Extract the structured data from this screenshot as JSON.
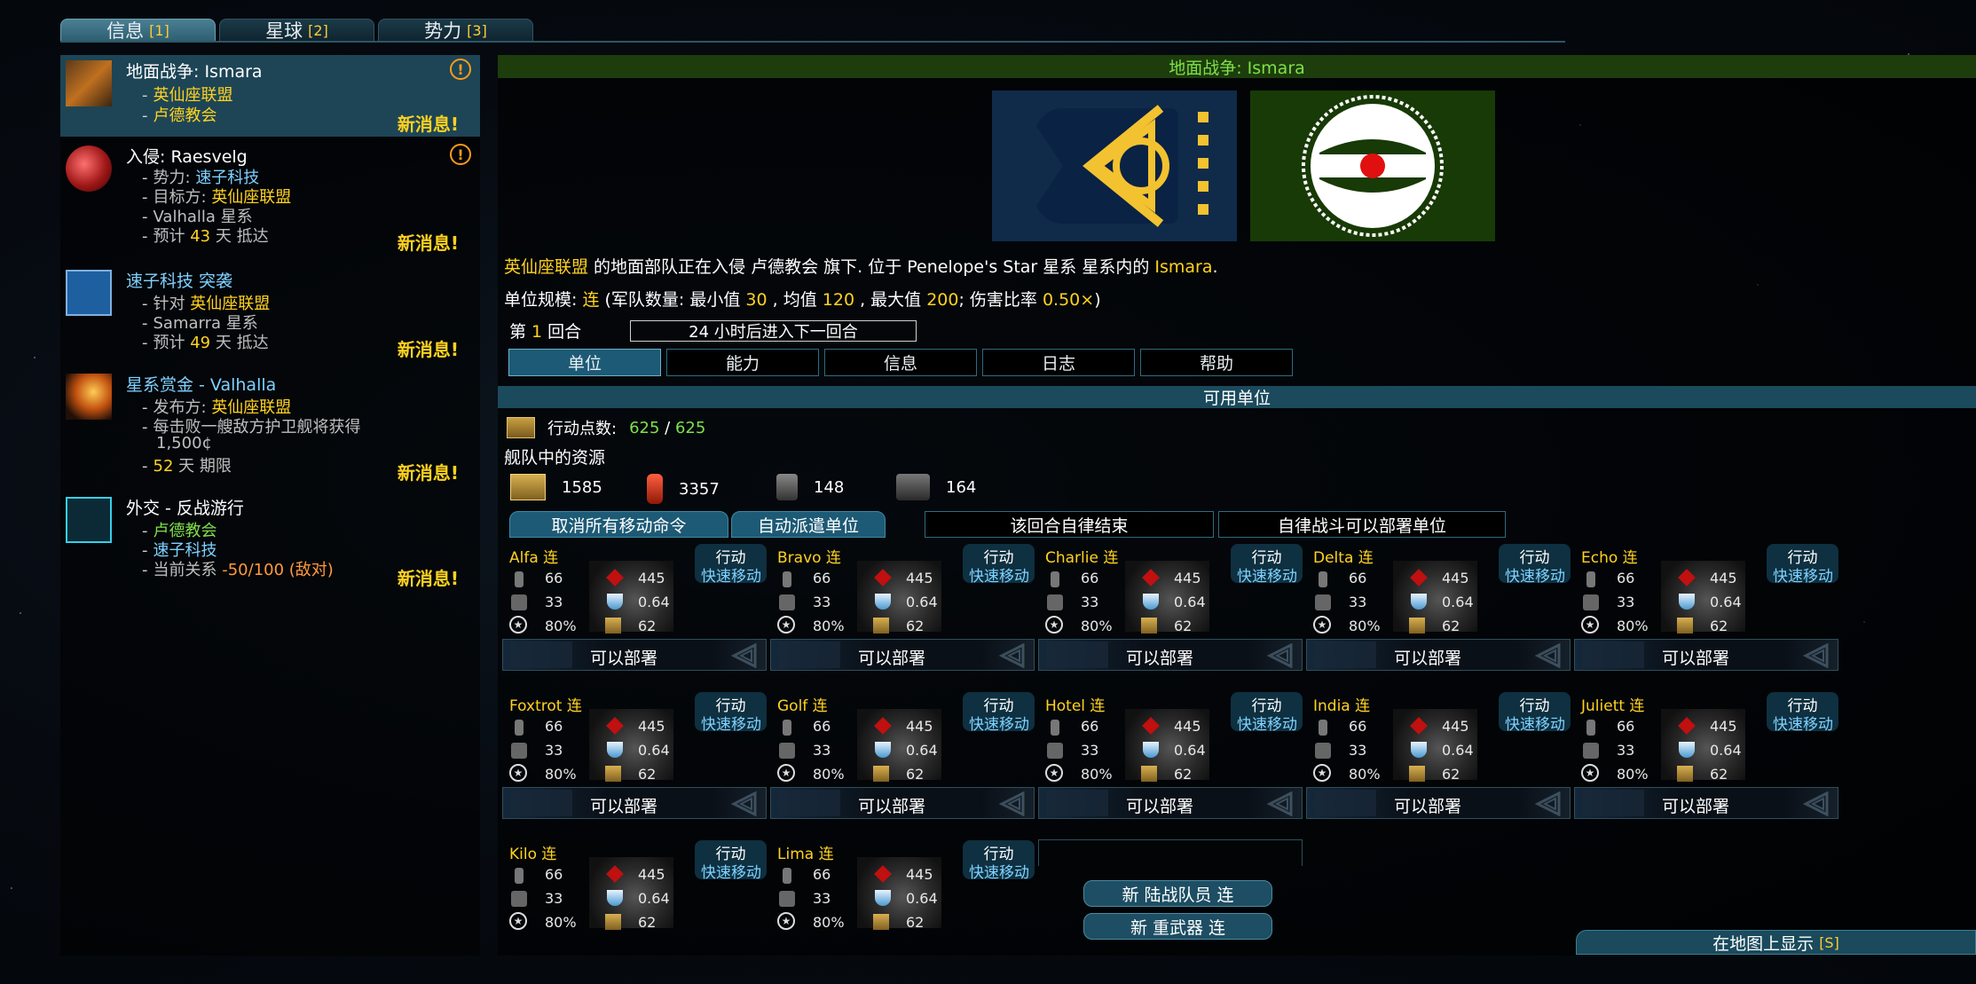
{
  "top_tabs": [
    {
      "label": "信息",
      "hotkey": "[1]"
    },
    {
      "label": "星球",
      "hotkey": "[2]"
    },
    {
      "label": "势力",
      "hotkey": "[3]"
    }
  ],
  "notifications": [
    {
      "title": "地面战争: Ismara",
      "lines": [
        "英仙座联盟",
        "卢德教会"
      ],
      "new": "新消息!",
      "alert": "!"
    },
    {
      "title": "入侵: Raesvelg",
      "l1_label": "势力:",
      "l1_value": "速子科技",
      "l2_label": "目标方:",
      "l2_value": "英仙座联盟",
      "l3": "Valhalla 星系",
      "l4_pre": "预计",
      "l4_num": "43",
      "l4_post": "天 抵达",
      "new": "新消息!",
      "alert": "!"
    },
    {
      "title": "速子科技 突袭",
      "l1_label": "针对",
      "l1_value": "英仙座联盟",
      "l2": "Samarra 星系",
      "l3_pre": "预计",
      "l3_num": "49",
      "l3_post": "天 抵达",
      "new": "新消息!"
    },
    {
      "title": "星系赏金 - Valhalla",
      "l1_label": "发布方:",
      "l1_value": "英仙座联盟",
      "l2": "每击败一艘敌方护卫舰将获得",
      "l3": "1,500¢",
      "l4_num": "52",
      "l4_post": "天 期限",
      "new": "新消息!"
    },
    {
      "title": "外交 - 反战游行",
      "l1": "卢德教会",
      "l2": "速子科技",
      "l3_label": "当前关系",
      "l3_value": "-50/100 (敌对)",
      "new": "新消息!"
    }
  ],
  "main": {
    "title": "地面战争: Ismara",
    "desc": {
      "a": "英仙座联盟",
      "b": " 的地面部队正在入侵 卢德教会 旗下. 位于 Penelope's Star 星系 星系内的 ",
      "c": "Ismara",
      "d": "."
    },
    "scale": {
      "label": "单位规模: ",
      "size": "连",
      "p1": " (军队数量: 最小值 ",
      "min": "30",
      "p2": " , 均值 ",
      "avg": "120",
      "p3": " , 最大值 ",
      "max": "200",
      "p4": "; 伤害比率 ",
      "ratio": "0.50×",
      "p5": ")"
    },
    "turn": {
      "pre": "第 ",
      "num": "1",
      "post": " 回合",
      "next": "24 小时后进入下一回合"
    },
    "subtabs": [
      "单位",
      "能力",
      "信息",
      "日志",
      "帮助"
    ],
    "avail_title": "可用单位",
    "ap": {
      "label": "行动点数:",
      "cur": "625",
      "sep": " / ",
      "max": "625"
    },
    "fleet_res_title": "舰队中的资源",
    "resources": [
      "1585",
      "3357",
      "148",
      "164"
    ],
    "buttons": [
      "取消所有移动命令",
      "自动派遣单位",
      "该回合自律结束",
      "自律战斗可以部署单位"
    ],
    "new_buttons": [
      "新 陆战队员 连",
      "新 重武器 连"
    ],
    "map_button": {
      "label": "在地图上显示",
      "hotkey": "[S]"
    }
  },
  "unit_common": {
    "act": "行动",
    "fast": "快速移动",
    "s1": "66",
    "s2": "33",
    "s3": "80%",
    "s4": "445",
    "s5": "0.64",
    "s6": "62",
    "deploy": "可以部署"
  },
  "units": [
    "Alfa 连",
    "Bravo 连",
    "Charlie 连",
    "Delta 连",
    "Echo 连",
    "Foxtrot 连",
    "Golf 连",
    "Hotel 连",
    "India 连",
    "Juliett 连",
    "Kilo 连",
    "Lima 连"
  ],
  "colors": {
    "accent_yellow": "#ffd21f",
    "accent_green": "#7fe04a",
    "panel_blue": "#1d4556"
  }
}
